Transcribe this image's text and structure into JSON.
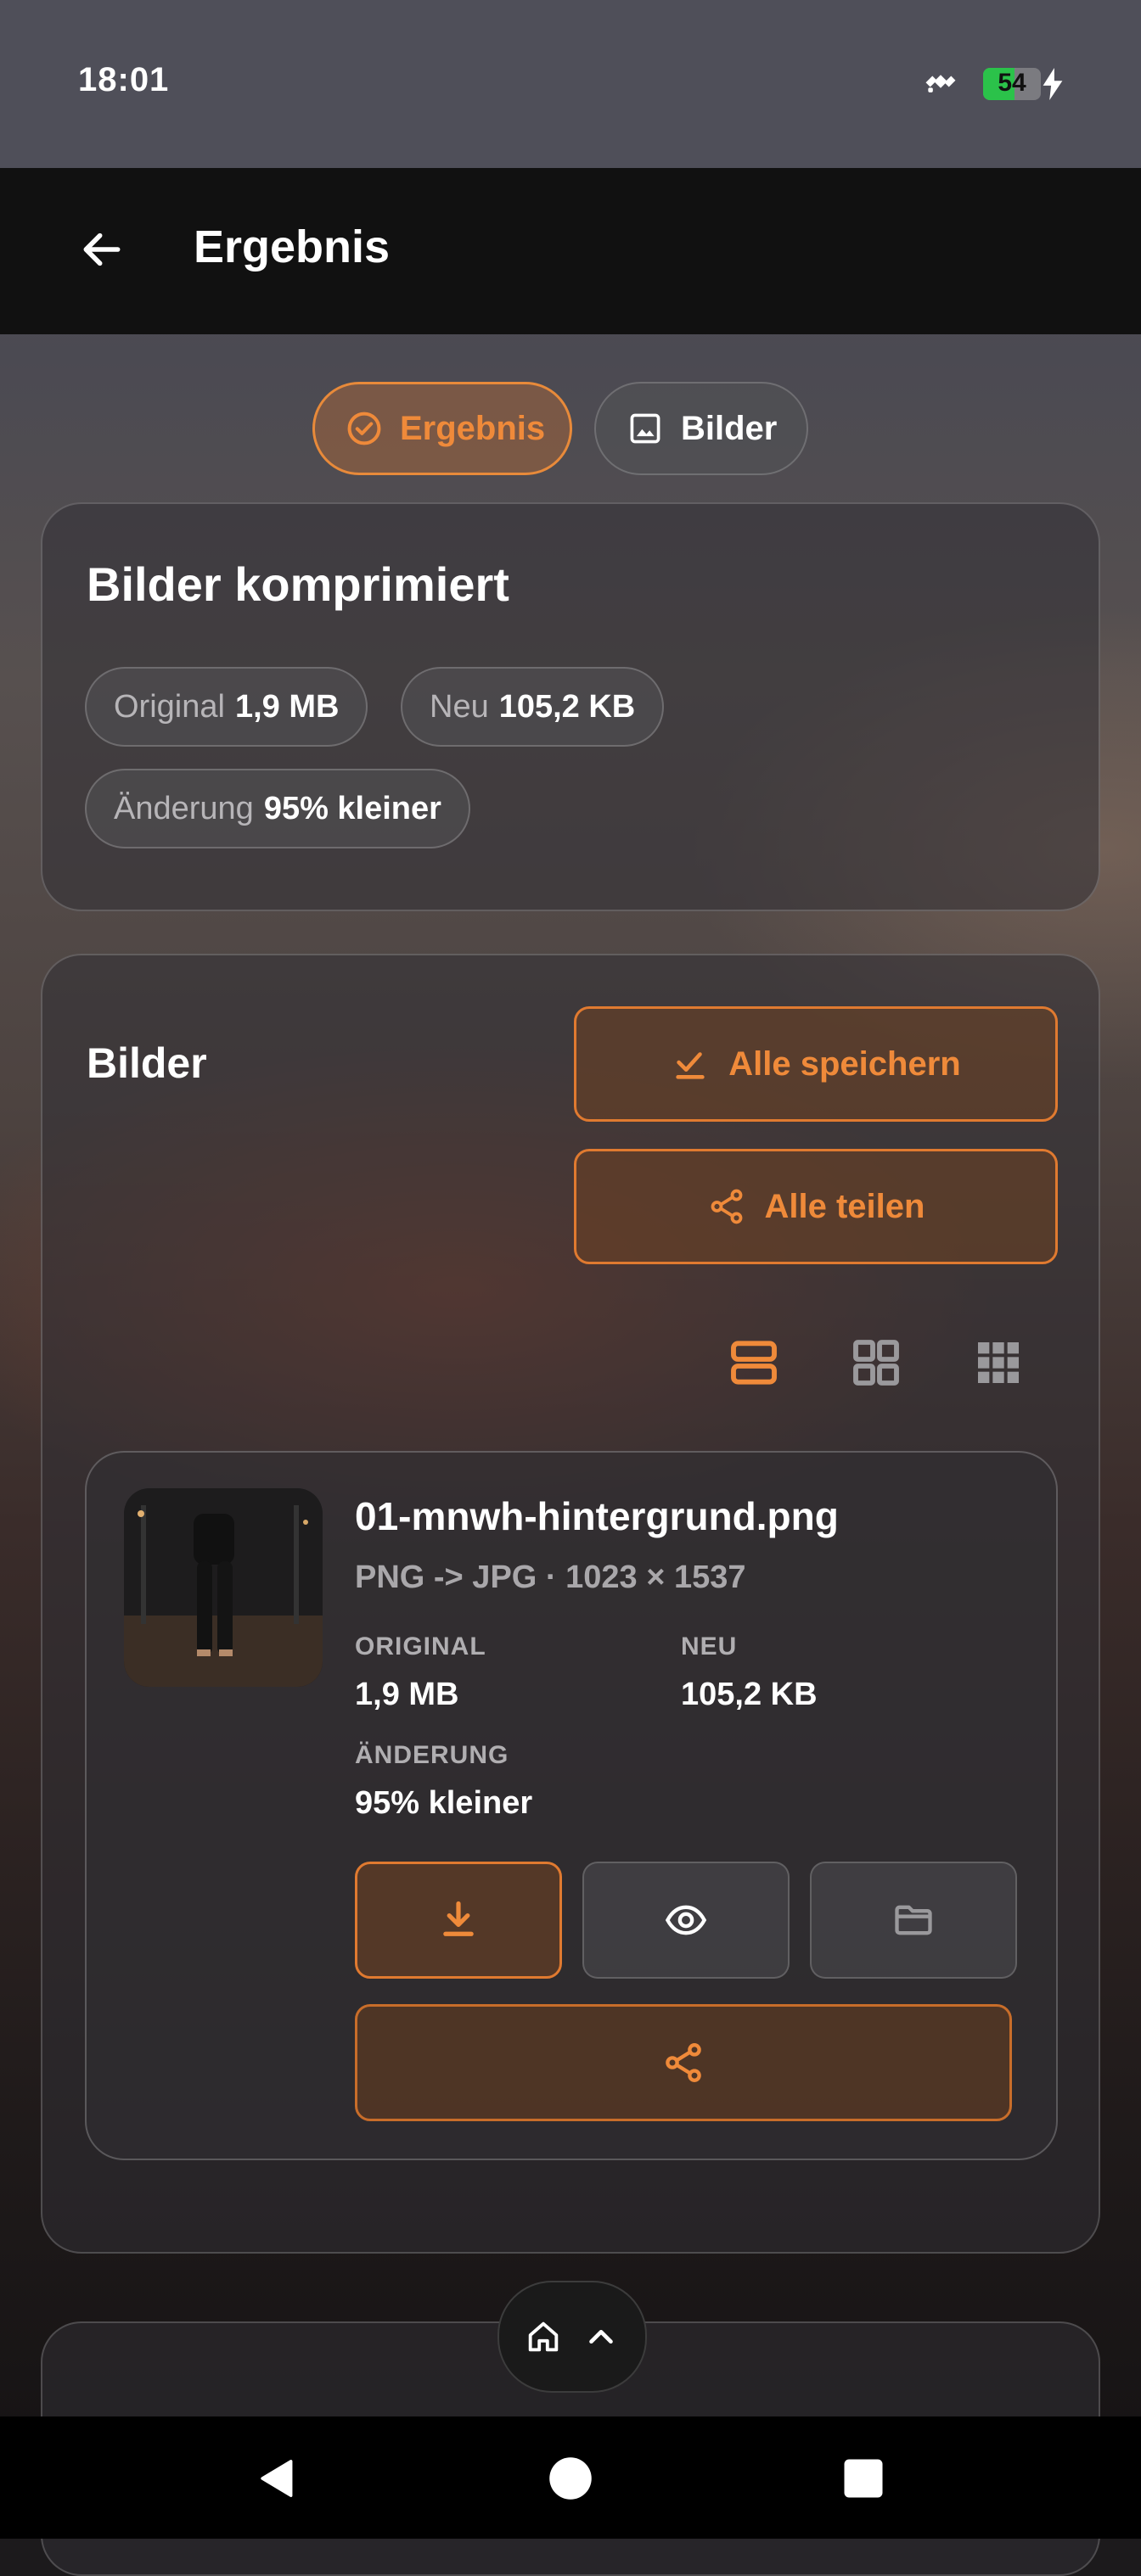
{
  "status_bar": {
    "time": "18:01",
    "battery_level": "54",
    "battery_fraction": 0.54
  },
  "app_bar": {
    "title": "Ergebnis"
  },
  "tabs": [
    {
      "label": "Ergebnis",
      "selected": true
    },
    {
      "label": "Bilder",
      "selected": false
    }
  ],
  "summary": {
    "heading": "Bilder komprimiert",
    "chips": [
      {
        "key": "Original",
        "value": "1,9 MB"
      },
      {
        "key": "Neu",
        "value": "105,2 KB"
      },
      {
        "key": "Änderung",
        "value": "95% kleiner"
      }
    ]
  },
  "images_section": {
    "heading": "Bilder",
    "save_all_label": "Alle speichern",
    "share_all_label": "Alle teilen",
    "layout_options": [
      "list",
      "grid-large",
      "grid-small"
    ],
    "selected_layout": "list",
    "items": [
      {
        "filename": "01-mnwh-hintergrund.png",
        "meta": "PNG -> JPG · 1023 × 1537",
        "original_label": "ORIGINAL",
        "original_value": "1,9 MB",
        "new_label": "NEU",
        "new_value": "105,2 KB",
        "change_label": "ÄNDERUNG",
        "change_value": "95% kleiner"
      }
    ]
  },
  "colors": {
    "accent": "#ef8a3a",
    "battery": "#2bc24a",
    "app_bar": "#111111"
  }
}
